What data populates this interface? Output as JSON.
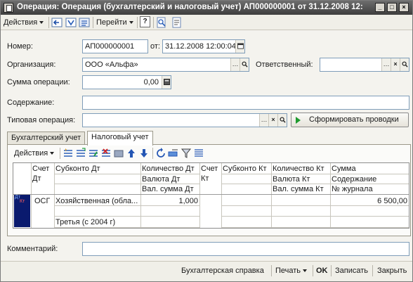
{
  "window": {
    "title": "Операция: Операция (бухгалтерский и налоговый учет) АП000000001 от 31.12.2008 12:",
    "minimize_glyph": "_",
    "restore_glyph": "□",
    "close_glyph": "×"
  },
  "toolbar": {
    "actions_label": "Действия",
    "goto_label": "Перейти",
    "help_label": "?"
  },
  "form": {
    "number_label": "Номер:",
    "number_value": "АП000000001",
    "date_label": "от:",
    "date_value": "31.12.2008 12:00:04",
    "org_label": "Организация:",
    "org_value": "ООО «Альфа»",
    "responsible_label": "Ответственный:",
    "responsible_value": "",
    "amount_label": "Сумма операции:",
    "amount_value": "0,00",
    "content_label": "Содержание:",
    "content_value": "",
    "typical_label": "Типовая операция:",
    "typical_value": "",
    "generate_button": "Сформировать проводки",
    "comment_label": "Комментарий:",
    "comment_value": ""
  },
  "tabs": [
    {
      "label": "Бухгалтерский учет",
      "active": false
    },
    {
      "label": "Налоговый учет",
      "active": true
    }
  ],
  "subtoolbar": {
    "actions_label": "Действия"
  },
  "table": {
    "headers": {
      "acc_dt": "Счет Дт",
      "subconto_dt": "Субконто Дт",
      "qty_dt": "Количество Дт",
      "cur_dt": "Валюта Дт",
      "cur_sum_dt": "Вал. сумма Дт",
      "acc_kt": "Счет Кт",
      "subconto_kt": "Субконто Кт",
      "qty_kt": "Количество Кт",
      "cur_kt": "Валюта Кт",
      "cur_sum_kt": "Вал. сумма Кт",
      "sum": "Сумма",
      "content": "Содержание",
      "journal": "№ журнала"
    },
    "row": {
      "icon_top": "Дт",
      "icon_bottom": "Кт",
      "acc_dt": "ОСГ",
      "subconto_dt_1": "Хозяйственная (обла...",
      "subconto_dt_3": "Третья (с 2004 г)",
      "qty_dt": "1,000",
      "sum": "6 500,00"
    }
  },
  "statusbar": {
    "report_label": "Бухгалтерская справка",
    "print_label": "Печать",
    "ok_label": "OK",
    "save_label": "Записать",
    "close_label": "Закрыть"
  }
}
